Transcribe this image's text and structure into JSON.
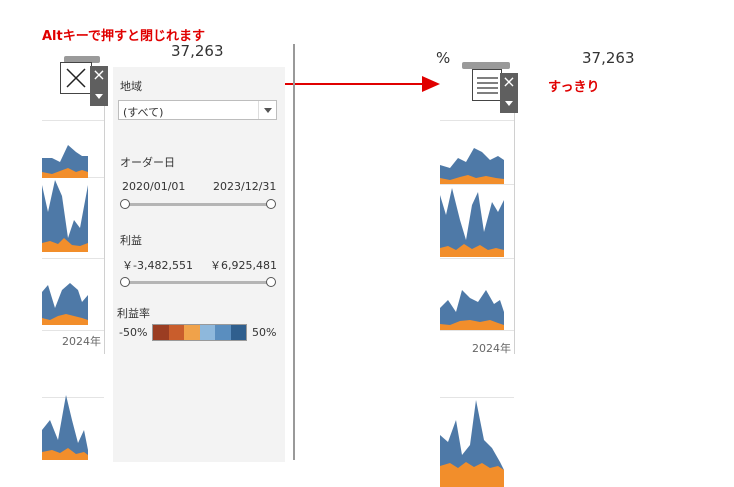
{
  "annotations": {
    "alt_hint": "Altキーで押すと閉じれます",
    "clean_hint": "すっきり"
  },
  "left_view": {
    "kpi_value": "37,263",
    "year_label": "2024年"
  },
  "right_view": {
    "kpi_value": "37,263",
    "percent_fragment": "%",
    "year_label": "2024年"
  },
  "filters": {
    "region": {
      "label": "地域",
      "selected": "(すべて)"
    },
    "order_date": {
      "label": "オーダー日",
      "min": "2020/01/01",
      "max": "2023/12/31"
    },
    "profit": {
      "label": "利益",
      "min": "￥-3,482,551",
      "max": "￥6,925,481"
    },
    "profit_rate": {
      "label": "利益率",
      "min": "-50%",
      "max": "50%"
    }
  },
  "colors": {
    "accent_red": "#e00000",
    "series_blue": "#4e79a7",
    "series_orange": "#f28e2b",
    "ramp": [
      "#9b3d22",
      "#c95d2c",
      "#f0a24a",
      "#8eb8dc",
      "#5a8ebf",
      "#2f5f8e"
    ]
  },
  "icons": {
    "left_card": "close-x-icon",
    "right_card": "list-lines-icon",
    "close": "close-icon",
    "dropdown": "caret-down-icon"
  }
}
